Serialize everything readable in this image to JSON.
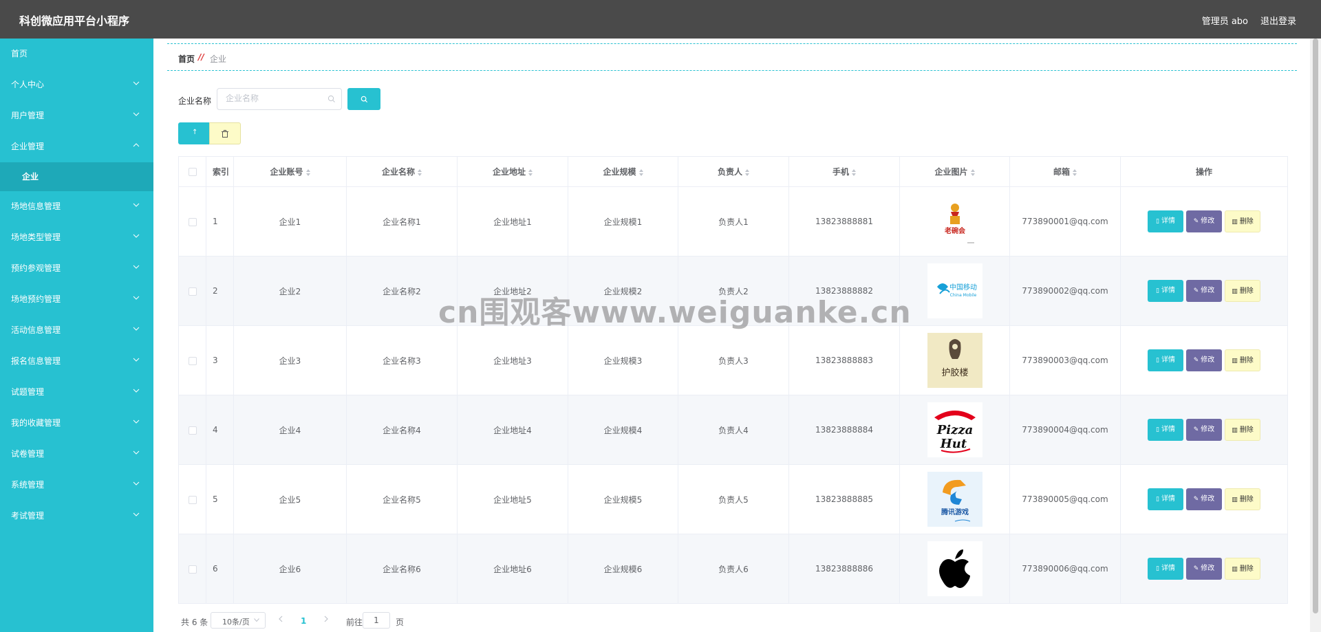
{
  "header": {
    "title": "科创微应用平台小程序",
    "user": "管理员 abo",
    "logout": "退出登录"
  },
  "sidebar": {
    "items": [
      {
        "label": "首页",
        "chevron": false
      },
      {
        "label": "个人中心",
        "chevron": "down"
      },
      {
        "label": "用户管理",
        "chevron": "down"
      },
      {
        "label": "企业管理",
        "chevron": "up"
      },
      {
        "label": "企业",
        "sub": true
      },
      {
        "label": "场地信息管理",
        "chevron": "down"
      },
      {
        "label": "场地类型管理",
        "chevron": "down"
      },
      {
        "label": "预约参观管理",
        "chevron": "down"
      },
      {
        "label": "场地预约管理",
        "chevron": "down"
      },
      {
        "label": "活动信息管理",
        "chevron": "down"
      },
      {
        "label": "报名信息管理",
        "chevron": "down"
      },
      {
        "label": "试题管理",
        "chevron": "down"
      },
      {
        "label": "我的收藏管理",
        "chevron": "down"
      },
      {
        "label": "试卷管理",
        "chevron": "down"
      },
      {
        "label": "系统管理",
        "chevron": "down"
      },
      {
        "label": "考试管理",
        "chevron": "down"
      }
    ]
  },
  "breadcrumb": {
    "home": "首页",
    "separator": "//",
    "current": "企业"
  },
  "search": {
    "label": "企业名称",
    "placeholder": "企业名称",
    "value": ""
  },
  "toolbar": {
    "add_glyph": "↑"
  },
  "table": {
    "headers": {
      "index": "索引",
      "account": "企业账号",
      "name": "企业名称",
      "address": "企业地址",
      "scale": "企业规模",
      "contact": "负责人",
      "phone": "手机",
      "image": "企业图片",
      "email": "邮箱",
      "actions": "操作"
    },
    "rows": [
      {
        "index": "1",
        "account": "企业1",
        "name": "企业名称1",
        "address": "企业地址1",
        "scale": "企业规模1",
        "contact": "负责人1",
        "phone": "13823888881",
        "email": "773890001@qq.com",
        "logo": "shaanxi-restaurant-logo",
        "logo_text": "老碗会"
      },
      {
        "index": "2",
        "account": "企业2",
        "name": "企业名称2",
        "address": "企业地址2",
        "scale": "企业规模2",
        "contact": "负责人2",
        "phone": "13823888882",
        "email": "773890002@qq.com",
        "logo": "china-mobile-logo",
        "logo_text": "中国移动",
        "logo_text2": "China Mobile"
      },
      {
        "index": "3",
        "account": "企业3",
        "name": "企业名称3",
        "address": "企业地址3",
        "scale": "企业规模3",
        "contact": "负责人3",
        "phone": "13823888883",
        "email": "773890003@qq.com",
        "logo": "calligraphy-logo",
        "logo_text": "护胶楼"
      },
      {
        "index": "4",
        "account": "企业4",
        "name": "企业名称4",
        "address": "企业地址4",
        "scale": "企业规模4",
        "contact": "负责人4",
        "phone": "13823888884",
        "email": "773890004@qq.com",
        "logo": "pizza-hut-logo",
        "logo_text": "Pizza",
        "logo_text2": "Hut"
      },
      {
        "index": "5",
        "account": "企业5",
        "name": "企业名称5",
        "address": "企业地址5",
        "scale": "企业规模5",
        "contact": "负责人5",
        "phone": "13823888885",
        "email": "773890005@qq.com",
        "logo": "tencent-games-logo",
        "logo_text": "腾讯游戏"
      },
      {
        "index": "6",
        "account": "企业6",
        "name": "企业名称6",
        "address": "企业地址6",
        "scale": "企业规模6",
        "contact": "负责人6",
        "phone": "13823888886",
        "email": "773890006@qq.com",
        "logo": "apple-logo"
      }
    ],
    "action_labels": {
      "detail": "详情",
      "edit": "修改",
      "delete": "删除"
    }
  },
  "pagination": {
    "total": "共 6 条",
    "page_size": "10条/页",
    "current_page": "1",
    "goto_label": "前往",
    "goto_value": "1",
    "page_suffix": "页"
  },
  "watermark": "cn围观客www.weiguanke.cn",
  "colors": {
    "primary": "#27c1d1",
    "header": "#4a4a4a",
    "edit": "#6f6aa3",
    "delete": "#fdfbc8"
  }
}
